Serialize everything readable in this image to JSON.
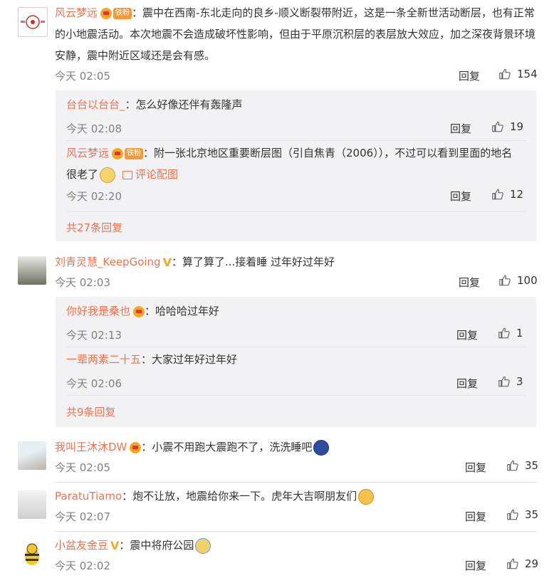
{
  "comments": [
    {
      "user": "风云梦远",
      "badge": "铁粉",
      "text": "：震中在西南-东北走向的良乡-顺义断裂带附近，这是一条全新世活动断层，也有正常的小地震活动。本次地震不会造成破坏性影响，但由于平原沉积层的表层放大效应，加之深夜背景环境安静，震中附近区域还是会有感。",
      "time": "今天 02:05",
      "reply": "回复",
      "likes": "154",
      "replies": [
        {
          "user": "台台以台台_",
          "text": "：怎么好像还伴有轰隆声",
          "time": "今天 02:08",
          "reply": "回复",
          "likes": "19"
        },
        {
          "user": "风云梦远",
          "badge": "铁粉",
          "text": "：附一张北京地区重要断层图（引自焦青（2006）），不过可以看到里面的地名很老了",
          "pic_link": "评论配图",
          "time": "今天 02:20",
          "reply": "回复",
          "likes": "12"
        }
      ],
      "more": "共27条回复"
    },
    {
      "user": "刘青灵慧_KeepGoing",
      "text": "：算了算了...接着睡 过年好过年好",
      "time": "今天 02:03",
      "reply": "回复",
      "likes": "100",
      "replies": [
        {
          "user": "你好我是桑也",
          "text": "：哈哈哈过年好",
          "time": "今天 02:13",
          "reply": "回复",
          "likes": "1"
        },
        {
          "user": "一辈两素二十五",
          "text": "：大家过年好过年好",
          "time": "今天 02:06",
          "reply": "回复",
          "likes": "3"
        }
      ],
      "more": "共9条回复"
    },
    {
      "user": "我叫王沐沐DW",
      "text": "：小震不用跑大震跑不了，洗洗睡吧",
      "time": "今天 02:05",
      "reply": "回复",
      "likes": "35"
    },
    {
      "user": "ParatuTiamo",
      "text": "：炮不让放，地震给你来一下。虎年大吉啊朋友们",
      "time": "今天 02:07",
      "reply": "回复",
      "likes": "35"
    },
    {
      "user": "小盆友金豆",
      "text": "：震中将府公园",
      "time": "今天 02:02",
      "reply": "回复",
      "likes": "29"
    }
  ],
  "colors": {
    "name": "#eb7350",
    "time": "#808080",
    "sub_bg": "#f2f2f5"
  }
}
